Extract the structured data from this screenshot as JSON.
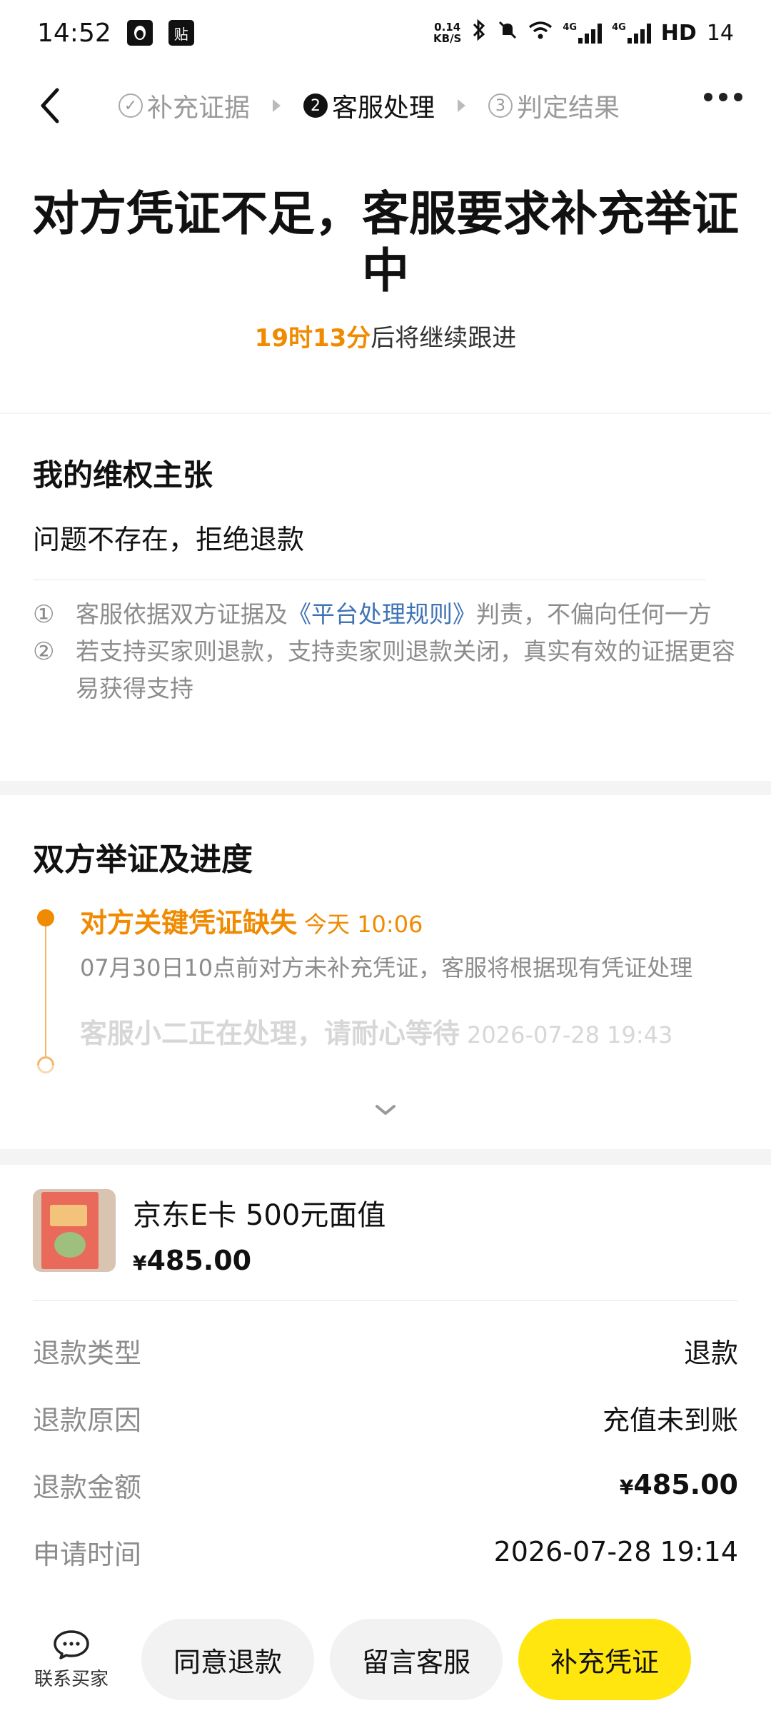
{
  "status_bar": {
    "time": "14:52",
    "app_icon_1": "penguin",
    "app_icon_2": "贴",
    "net_speed": "0.14",
    "net_unit": "KB/S",
    "sig1": "4G",
    "sig2": "4G",
    "hd": "HD",
    "battery": "14"
  },
  "nav": {
    "steps": [
      {
        "num": "✓",
        "label": "补充证据"
      },
      {
        "num": "2",
        "label": "客服处理"
      },
      {
        "num": "3",
        "label": "判定结果"
      }
    ]
  },
  "hero": {
    "title": "对方凭证不足，客服要求补充举证中",
    "countdown": "19时13分",
    "countdown_suffix": "后将继续跟进"
  },
  "claim": {
    "heading": "我的维权主张",
    "value": "问题不存在，拒绝退款",
    "notes": [
      {
        "idx": "①",
        "pre": "客服依据双方证据及",
        "link": "《平台处理规则》",
        "post": "判责，不偏向任何一方"
      },
      {
        "idx": "②",
        "text": "若支持买家则退款，支持卖家则退款关闭，真实有效的证据更容易获得支持"
      }
    ]
  },
  "progress": {
    "heading": "双方举证及进度",
    "items": [
      {
        "title": "对方关键凭证缺失",
        "time": "今天 10:06",
        "desc": "07月30日10点前对方未补充凭证，客服将根据现有凭证处理"
      },
      {
        "title": "客服小二正在处理，请耐心等待",
        "time": "2026-07-28 19:43"
      }
    ]
  },
  "order": {
    "product_name": "京东E卡 500元面值",
    "currency": "¥",
    "price": "485.00",
    "rows": [
      {
        "key": "退款类型",
        "value": "退款"
      },
      {
        "key": "退款原因",
        "value": "充值未到账"
      },
      {
        "key": "退款金额",
        "currency": "¥",
        "value": "485.00"
      },
      {
        "key": "申请时间",
        "value": "2026-07-28 19:14"
      }
    ]
  },
  "bottom": {
    "contact_label": "联系买家",
    "agree": "同意退款",
    "message": "留言客服",
    "supplement": "补充凭证"
  },
  "colors": {
    "accent_orange": "#f08a00",
    "link_blue": "#3f73b5",
    "primary_yellow": "#ffe60f"
  }
}
